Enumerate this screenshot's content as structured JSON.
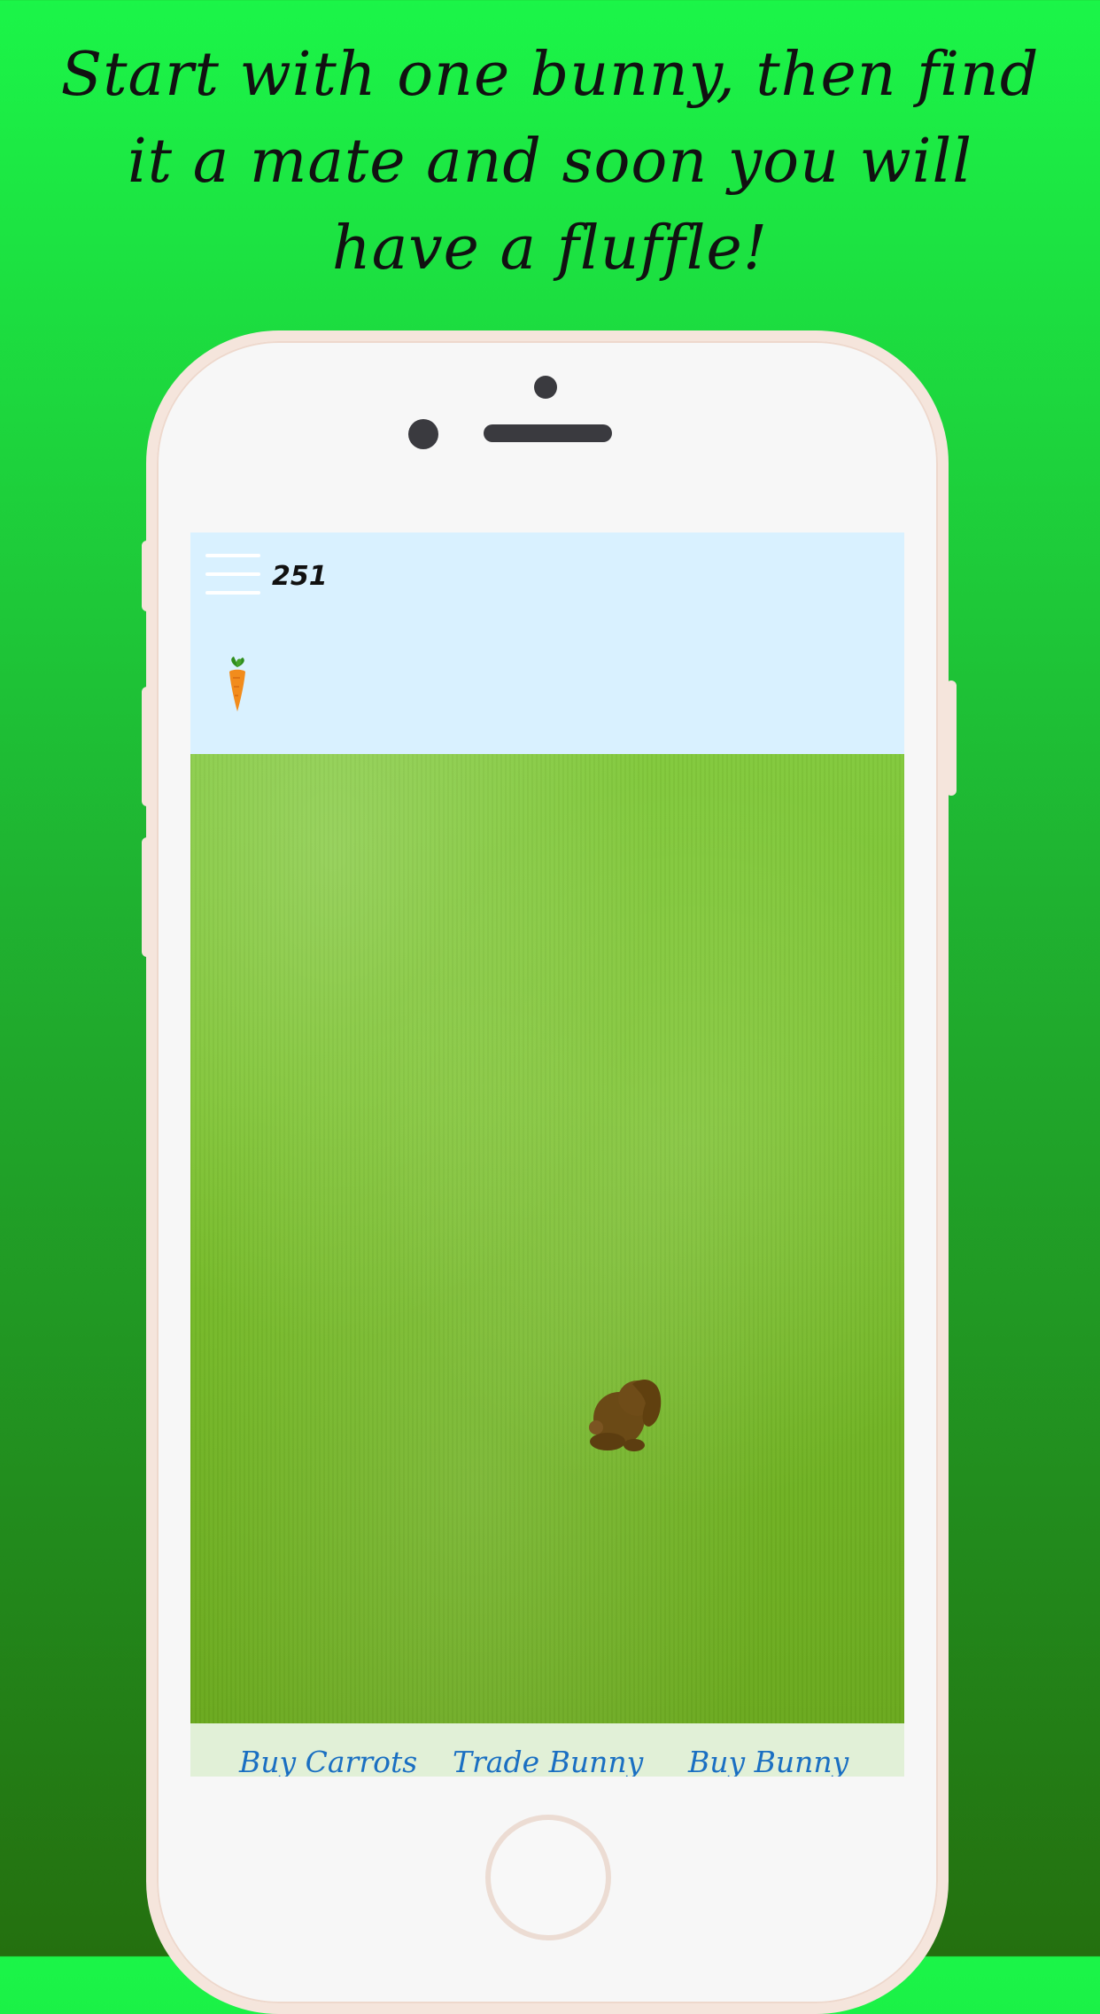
{
  "promo": {
    "line1": "Start with one bunny, then find",
    "line2": "it a mate and soon you will",
    "line3": "have a fluffle!"
  },
  "game": {
    "carrot_count": "251",
    "menu_icon": "hamburger-menu-icon",
    "carrot_icon": "carrot-icon",
    "bunny_icon": "bunny-icon"
  },
  "actions": {
    "buy_carrots": "Buy Carrots",
    "trade_bunny": "Trade Bunny",
    "buy_bunny": "Buy Bunny"
  },
  "colors": {
    "background_top": "#1bf548",
    "background_bottom": "#24700f",
    "sky": "#d9f1ff",
    "grass": "#7cc32f",
    "bunny": "#6b4a16",
    "button_text": "#1a6fc2",
    "phone_frame": "#f5e5dc"
  }
}
